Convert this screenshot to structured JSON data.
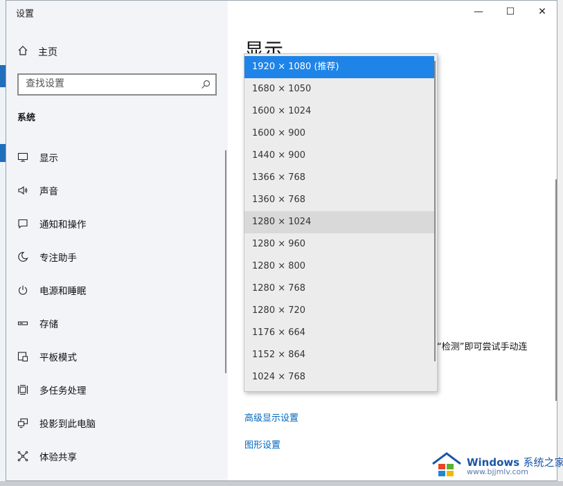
{
  "window": {
    "title": "设置"
  },
  "titlebar": {
    "minimize": "—",
    "maximize": "☐",
    "close": "✕"
  },
  "nav": {
    "home_label": "主页",
    "search_placeholder": "查找设置",
    "section_title": "系统",
    "items": [
      {
        "label": "显示",
        "icon": "monitor-icon"
      },
      {
        "label": "声音",
        "icon": "speaker-icon"
      },
      {
        "label": "通知和操作",
        "icon": "notification-icon"
      },
      {
        "label": "专注助手",
        "icon": "moon-icon"
      },
      {
        "label": "电源和睡眠",
        "icon": "power-icon"
      },
      {
        "label": "存储",
        "icon": "storage-icon"
      },
      {
        "label": "平板模式",
        "icon": "tablet-icon"
      },
      {
        "label": "多任务处理",
        "icon": "multitask-icon"
      },
      {
        "label": "投影到此电脑",
        "icon": "project-icon"
      },
      {
        "label": "体验共享",
        "icon": "share-icon"
      }
    ]
  },
  "content": {
    "heading": "显示",
    "partial_text": "“检测”即可尝试手动连",
    "links": {
      "advanced": "高级显示设置",
      "graphics": "图形设置"
    }
  },
  "resolution_dropdown": {
    "selected_index": 0,
    "hover_index": 7,
    "options": [
      "1920 × 1080 (推荐)",
      "1680 × 1050",
      "1600 × 1024",
      "1600 × 900",
      "1440 × 900",
      "1366 × 768",
      "1360 × 768",
      "1280 × 1024",
      "1280 × 960",
      "1280 × 800",
      "1280 × 768",
      "1280 × 720",
      "1176 × 664",
      "1152 × 864",
      "1024 × 768"
    ]
  },
  "watermark": {
    "brand": "Windows",
    "cn": "系统之家",
    "url": "www.bjjmlv.com"
  },
  "colors": {
    "accent": "#1e84e8",
    "link": "#0067c0",
    "nav_bg": "#f2f4f7"
  }
}
